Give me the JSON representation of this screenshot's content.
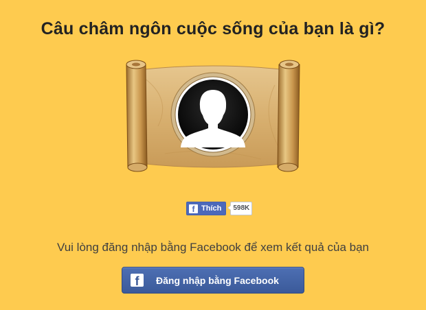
{
  "page": {
    "title": "Câu châm ngôn cuộc sống của bạn là gì?",
    "prompt": "Vui lòng đăng nhập bằng Facebook để xem kết quả của bạn"
  },
  "like_widget": {
    "label": "Thích",
    "count": "598K",
    "icon": "facebook-f-icon"
  },
  "login_button": {
    "label": "Đăng nhập bằng Facebook",
    "icon": "facebook-f-icon"
  },
  "colors": {
    "background": "#fecb4f",
    "facebook_blue": "#3b5998",
    "scroll_paper": "#d9b579"
  },
  "illustration": {
    "type": "parchment-scroll-with-default-profile-avatar"
  }
}
